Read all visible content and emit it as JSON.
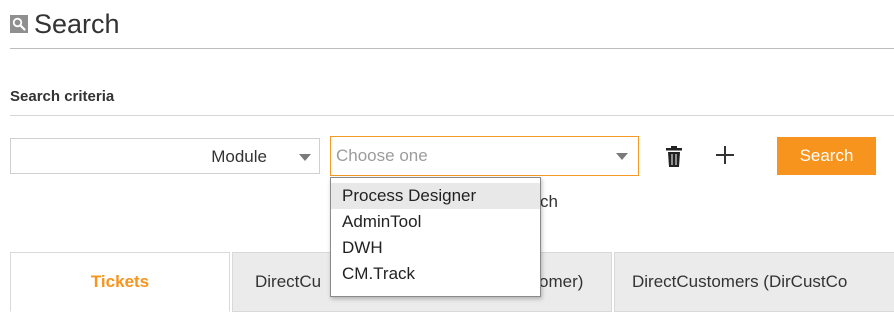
{
  "header": {
    "title": "Search",
    "icon": "search-icon"
  },
  "criteria": {
    "section_title": "Search criteria",
    "field_value": "Module",
    "value_placeholder": "Choose one",
    "search_label": "Search",
    "trash_icon": "trash-icon",
    "add_icon": "plus-icon",
    "partial_text": "ch",
    "dropdown_options": [
      "Process Designer",
      "AdminTool",
      "DWH",
      "CM.Track"
    ],
    "highlighted_option": "Process Designer"
  },
  "tabs": [
    {
      "label": "Tickets",
      "active": true
    },
    {
      "label": "DirectCu",
      "active": false
    },
    {
      "label": "omer)",
      "active": false
    },
    {
      "label": "DirectCustomers (DirCustCo",
      "active": false
    }
  ],
  "colors": {
    "accent": "#f7941d",
    "focus_border": "#f59a23"
  }
}
